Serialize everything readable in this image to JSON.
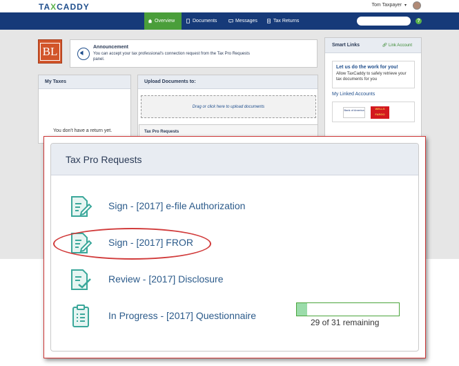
{
  "app": {
    "logo_left": "TA",
    "logo_x": "X",
    "logo_right": "CADDY",
    "user_name": "Tom Taxpayer",
    "user_chevron": "▾"
  },
  "nav": {
    "items": [
      {
        "label": "Overview",
        "icon": "home-icon",
        "active": true
      },
      {
        "label": "Documents",
        "icon": "document-icon",
        "active": false
      },
      {
        "label": "Messages",
        "icon": "message-icon",
        "active": false
      },
      {
        "label": "Tax Returns",
        "icon": "tax-return-icon",
        "active": false
      }
    ],
    "help": "?"
  },
  "firm_logo": "BL",
  "announcement": {
    "title": "Announcement",
    "text": "You can accept your tax professional's connection request from the Tax Pro Requests panel."
  },
  "my_taxes": {
    "title": "My Taxes",
    "empty_text": "You don't have a return yet."
  },
  "upload": {
    "title": "Upload Documents to:",
    "drop_text": "Drag or click here to upload documents"
  },
  "mini_requests_title": "Tax Pro Requests",
  "smart_links": {
    "title": "Smart Links",
    "link_account": "Link Account",
    "promo_title": "Let us do the work for you!",
    "promo_text": "Allow TaxCaddy to safely retrieve your tax documents for you",
    "linked_title": "My Linked Accounts",
    "banks": [
      "Bank of America",
      "WELLS FARGO"
    ]
  },
  "tax_pro_requests": {
    "title": "Tax Pro Requests",
    "items": [
      {
        "label": "Sign - [2017] e-file Authorization",
        "icon": "sign-document-icon"
      },
      {
        "label": "Sign - [2017] FROR",
        "icon": "sign-document-icon"
      },
      {
        "label": "Review - [2017] Disclosure",
        "icon": "review-document-icon"
      },
      {
        "label": "In Progress - [2017] Questionnaire",
        "icon": "clipboard-icon"
      }
    ],
    "progress": {
      "remaining_text": "29 of 31 remaining",
      "completed": 2,
      "total": 31
    }
  },
  "colors": {
    "nav_bg": "#163a79",
    "nav_active": "#4a9e3a",
    "accent_green": "#4aa43a",
    "progress_fill": "#9bdcaa",
    "highlight_red": "#d13a3a",
    "icon_teal": "#3aa79a"
  }
}
